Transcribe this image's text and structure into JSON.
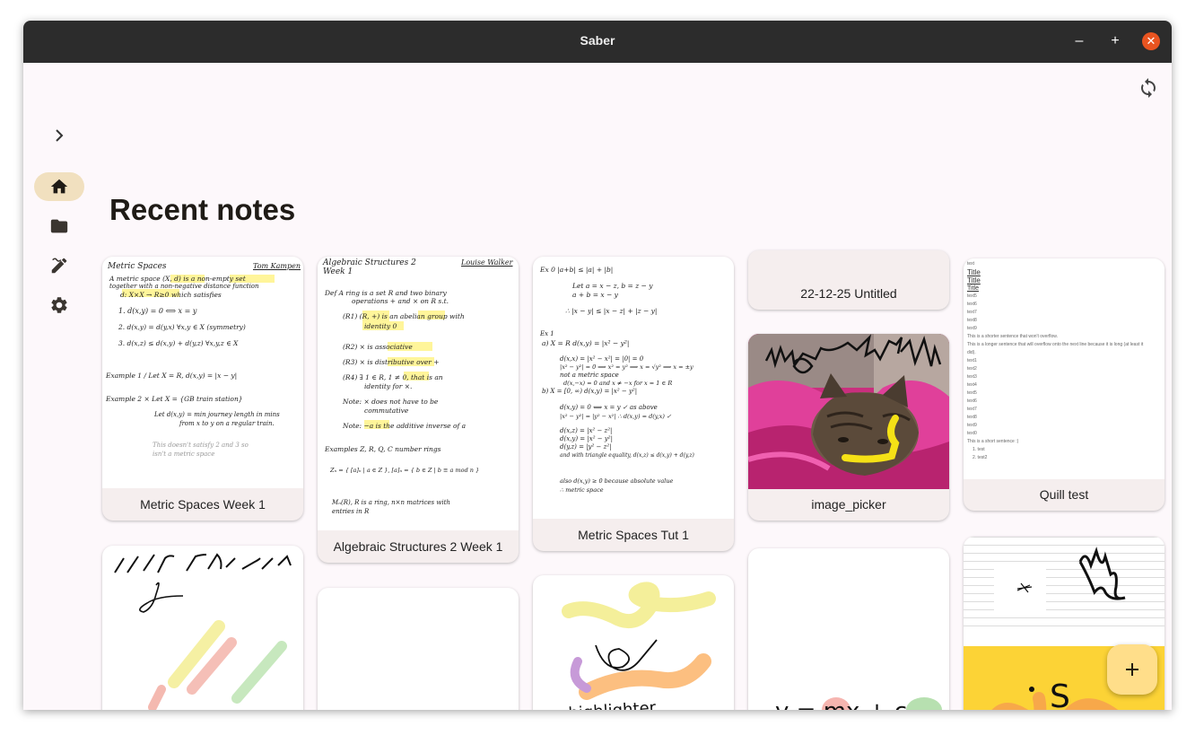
{
  "window": {
    "title": "Saber"
  },
  "controls": {
    "minimize": "‒",
    "maximize": "+",
    "close": "✕"
  },
  "nav": {
    "items": [
      {
        "name": "home",
        "active": true
      },
      {
        "name": "browse",
        "active": false
      },
      {
        "name": "whiteboard",
        "active": false
      },
      {
        "name": "settings",
        "active": false
      }
    ]
  },
  "main": {
    "title": "Recent notes"
  },
  "notes": [
    {
      "title": "Metric Spaces Week 1"
    },
    {
      "title": "Algebraic Structures 2 Week 1"
    },
    {
      "title": "Metric Spaces Tut 1"
    },
    {
      "title": "22-12-25 Untitled"
    },
    {
      "title": "image_picker"
    },
    {
      "title": "Quill test"
    }
  ],
  "previews": {
    "metric": {
      "heading": "Metric Spaces",
      "author": "Tom Kampen",
      "lines": [
        "A metric space (X, d) is a non-empty set",
        "together with a non-negative distance function",
        "d: X×X → R≥0 which satisfies",
        "1.  d(x,y) = 0   ⟺   x = y",
        "2.  d(x,y) = d(y,x)   ∀x,y ∈ X  (symmetry)",
        "3.  d(x,z) ≤ d(x,y) + d(y,z)   ∀x,y,z ∈ X",
        "Example 1 /  Let X = R,  d(x,y) = |x − y|",
        "Example 2 ×  Let X = {GB train station}",
        "Let d(x,y) = min journey length in mins",
        "from x to y on a regular train.",
        "This doesn't satisfy 2 and 3 so",
        "isn't a metric space"
      ]
    },
    "algebra": {
      "heading": "Algebraic Structures 2",
      "subheading": "Week 1",
      "author": "Louise Walker",
      "lines": [
        "Def  A ring is a set R and two binary",
        "operations + and × on R s.t.",
        "(R1)  (R, +) is an abelian group with",
        "identity 0",
        "(R2)  × is associative",
        "(R3)  × is distributive over +",
        "(R4)  ∃ 1 ∈ R,  1 ≠ 0,  that is an",
        "identity for ×.",
        "Note: × does not have to be",
        "commutative",
        "Note:  −a  is the additive inverse of a",
        "Examples   Z, R, Q, C  number rings",
        "Zₙ = { [a]ₙ | a ∈ Z },  [a]ₙ = { b ∈ Z | b ≡ a mod n }",
        "Mₙ(R),  R is a ring, n×n matrices with",
        "entries in R"
      ]
    },
    "tut": {
      "lines": [
        "Ex 0     |a+b| ≤ |a| + |b|",
        "Let a = x − z,  b = z − y",
        "a + b = x − y",
        "∴ |x − y| ≤ |x − z| + |z − y|",
        "Ex 1",
        "a)  X = R    d(x,y) = |x² − y²|",
        "d(x,x) = |x² − x²| = |0| = 0",
        "|x² − y²| = 0  ⟹  x² = y²  ⟹  x = √y²  ⟹  x = ±y",
        "not a metric space",
        "d(x,−x) = 0  and  x ≠ −x  for x = 1 ∈ R",
        "b)  X = [0, ∞)    d(x,y) = |x² − y²|",
        "d(x,y) = 0  ⟺  x = y  ✓  as above",
        "|x² − y²| = |y² − x²|  ∴  d(x,y) = d(y,x) ✓",
        "d(x,z) = |x² − z²|",
        "d(x,y) = |x² − y²|",
        "d(y,z) = |y² − z²|",
        "and with triangle equality,  d(x,z) ≤ d(x,y) + d(y,z)",
        "also d(x,y) ≥ 0 because absolute value",
        "∴ metric space"
      ]
    },
    "quill": {
      "lines": [
        "text",
        "Title",
        "Title",
        "Title",
        "text5",
        "text6",
        "text7",
        "text8",
        "text9",
        "This is a shorter sentence that won't overflow.",
        "This is a longer sentence that will overflow onto the next line because it is long (at least it",
        "did).",
        "text1",
        "text2",
        "text3",
        "text4",
        "text5",
        "text6",
        "text7",
        "text8",
        "text9",
        "text0",
        "This is a short sentence :)",
        "1.  test",
        "2.  test2"
      ]
    },
    "highlighter": {
      "text": "highlighter"
    },
    "equation": {
      "text": "y = mx + c"
    }
  },
  "colors": {
    "accent": "#f1e0bf",
    "fab": "#ffde8a",
    "titlebar": "#2c2c2c",
    "close": "#e95420",
    "highlight": "#fff59a"
  }
}
